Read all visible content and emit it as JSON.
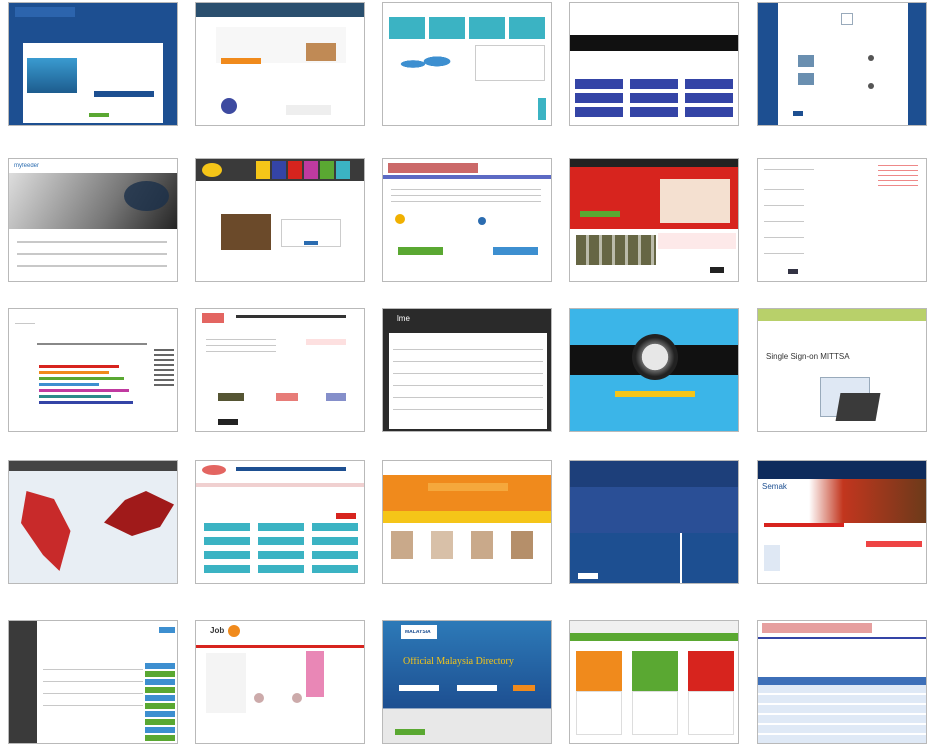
{
  "thumbnails": [
    {
      "id": "t01",
      "label": ""
    },
    {
      "id": "t02",
      "label": ""
    },
    {
      "id": "t03",
      "label": ""
    },
    {
      "id": "t04",
      "label": ""
    },
    {
      "id": "t05",
      "label": ""
    },
    {
      "id": "t06",
      "label": "myfeeder"
    },
    {
      "id": "t07",
      "label": ""
    },
    {
      "id": "t08",
      "label": ""
    },
    {
      "id": "t09",
      "label": ""
    },
    {
      "id": "t10",
      "label": ""
    },
    {
      "id": "t11",
      "label": ""
    },
    {
      "id": "t12",
      "label": ""
    },
    {
      "id": "t13",
      "label": "lme"
    },
    {
      "id": "t14",
      "label": ""
    },
    {
      "id": "t15",
      "label": "Single Sign-on MITTSA"
    },
    {
      "id": "t16",
      "label": ""
    },
    {
      "id": "t17",
      "label": ""
    },
    {
      "id": "t18",
      "label": ""
    },
    {
      "id": "t19",
      "label": ""
    },
    {
      "id": "t20",
      "label": "Semak"
    },
    {
      "id": "t21",
      "label": ""
    },
    {
      "id": "t22",
      "label": "Job"
    },
    {
      "id": "t23",
      "label": "Official Malaysia Directory",
      "sublabel": "MALAYSIA"
    },
    {
      "id": "t24",
      "label": ""
    },
    {
      "id": "t25",
      "label": ""
    }
  ],
  "colors": {
    "govBlue": "#1d4f91",
    "navy": "#0e2b5c",
    "teal": "#3bb3c3",
    "red": "#d7241e",
    "orange": "#f08a1c",
    "green": "#5aa832",
    "yellow": "#f5c518"
  }
}
